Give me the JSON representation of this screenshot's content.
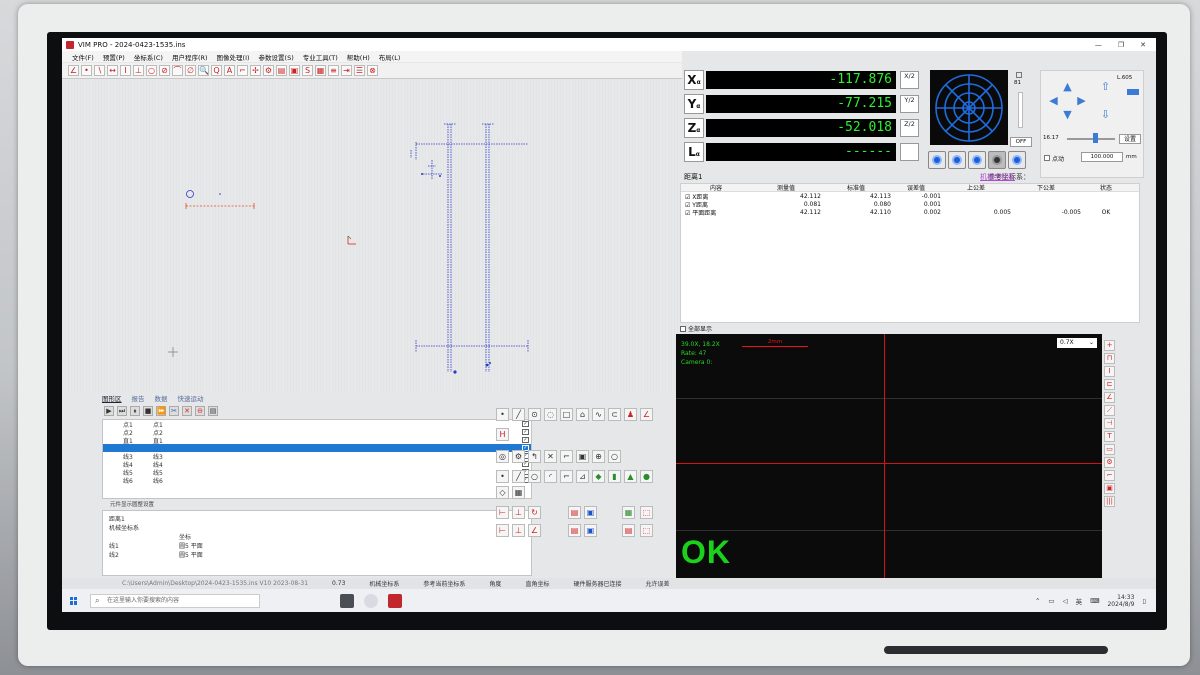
{
  "app": {
    "title": "VIM PRO - 2024-0423-1535.ins",
    "menu": [
      "文件(F)",
      "预置(P)",
      "坐标系(C)",
      "用户程序(R)",
      "图像处理(I)",
      "参数设置(S)",
      "专业工具(T)",
      "帮助(H)",
      "布局(L)"
    ]
  },
  "dro": {
    "axes": [
      {
        "axis": "X",
        "value": "-117.876",
        "half": "X/2"
      },
      {
        "axis": "Y",
        "value": "-77.215",
        "half": "Y/2"
      },
      {
        "axis": "Z",
        "value": "-52.018",
        "half": "Z/2"
      },
      {
        "axis": "L",
        "value": "------",
        "half": ""
      }
    ],
    "axis_sub": "α"
  },
  "lighting": {
    "level": "81",
    "off_label": "OFF"
  },
  "motion": {
    "speed_label": "L.605",
    "value_left": "16.17",
    "set_label": "设置",
    "auto_label": "点动",
    "distance": "100.000",
    "unit": "mm"
  },
  "measurement": {
    "title": "距离1",
    "ref_label": "参考坐标系：",
    "ref_value": "机械坐标系",
    "headers": [
      "内容",
      "测量值",
      "标准值",
      "误差值",
      "上公差",
      "下公差",
      "状态"
    ],
    "rows": [
      [
        "X距离",
        "42.112",
        "42.113",
        "-0.001",
        "",
        "",
        ""
      ],
      [
        "Y距离",
        "0.081",
        "0.080",
        "0.001",
        "",
        "",
        ""
      ],
      [
        "平面距离",
        "42.112",
        "42.110",
        "0.002",
        "0.005",
        "-0.005",
        "OK"
      ]
    ],
    "show_all": "全部显示"
  },
  "camera": {
    "info": [
      "39.0X, 18.2X",
      "Rate: 47",
      "Camera 0:"
    ],
    "scale": "2mm",
    "zoom": "0.7X",
    "result": "OK"
  },
  "feature_tabs": [
    "图形区",
    "报告",
    "数据",
    "快速运动"
  ],
  "features": [
    {
      "name": "点1",
      "type": "点1",
      "selected": false
    },
    {
      "name": "点2",
      "type": "点2",
      "selected": false
    },
    {
      "name": "直1",
      "type": "直1",
      "selected": false
    },
    {
      "name": "",
      "type": "",
      "selected": true
    },
    {
      "name": "线3",
      "type": "线3",
      "selected": false
    },
    {
      "name": "线4",
      "type": "线4",
      "selected": false
    },
    {
      "name": "线5",
      "type": "线5",
      "selected": false
    },
    {
      "name": "线6",
      "type": "线6",
      "selected": false
    }
  ],
  "feature_caption": "元件显示圆整设置",
  "result_pane": {
    "title": "距离1",
    "coord": "机械坐标系",
    "header": "坐标",
    "rows": [
      [
        "线1",
        "圆5 平面"
      ],
      [
        "线2",
        "圆5 平面"
      ]
    ]
  },
  "statusbar": [
    "C:\\Users\\Admin\\Desktop\\2024-0423-1535.ins V10 2023-08-31",
    "0.73",
    "机械坐标系",
    "参考当前坐标系",
    "角度",
    "直角坐标",
    "硬件服务器已连接",
    "允许误差"
  ],
  "taskbar": {
    "search": "在这里输入你要搜索的内容",
    "ime": "英",
    "time": "14:33",
    "date": "2024/8/9"
  }
}
